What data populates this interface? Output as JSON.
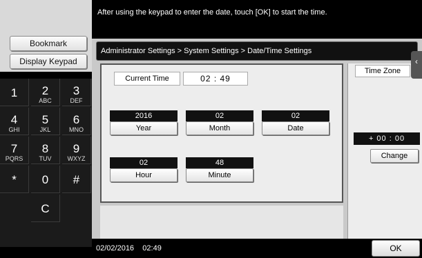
{
  "header": {
    "message": "After using the keypad to enter the date, touch [OK] to start the time."
  },
  "sidebar": {
    "bookmark_label": "Bookmark",
    "display_keypad_label": "Display Keypad"
  },
  "keypad": {
    "keys": [
      {
        "num": "1",
        "sub": ""
      },
      {
        "num": "2",
        "sub": "ABC"
      },
      {
        "num": "3",
        "sub": "DEF"
      },
      {
        "num": "4",
        "sub": "GHI"
      },
      {
        "num": "5",
        "sub": "JKL"
      },
      {
        "num": "6",
        "sub": "MNO"
      },
      {
        "num": "7",
        "sub": "PQRS"
      },
      {
        "num": "8",
        "sub": "TUV"
      },
      {
        "num": "9",
        "sub": "WXYZ"
      },
      {
        "num": "*",
        "sub": ""
      },
      {
        "num": "0",
        "sub": ""
      },
      {
        "num": "#",
        "sub": ""
      },
      {
        "num": "C",
        "sub": ""
      }
    ]
  },
  "breadcrumb": "Administrator Settings > System Settings > Date/Time Settings",
  "current_time": {
    "label": "Current Time",
    "value": "02 : 49"
  },
  "fields": {
    "year": {
      "value": "2016",
      "label": "Year"
    },
    "month": {
      "value": "02",
      "label": "Month"
    },
    "date": {
      "value": "02",
      "label": "Date"
    },
    "hour": {
      "value": "02",
      "label": "Hour"
    },
    "minute": {
      "value": "48",
      "label": "Minute"
    }
  },
  "timezone": {
    "label": "Time Zone",
    "value": "+ 00 : 00",
    "change_label": "Change"
  },
  "status": {
    "datetime": "02/02/2016    02:49",
    "ok_label": "OK"
  }
}
